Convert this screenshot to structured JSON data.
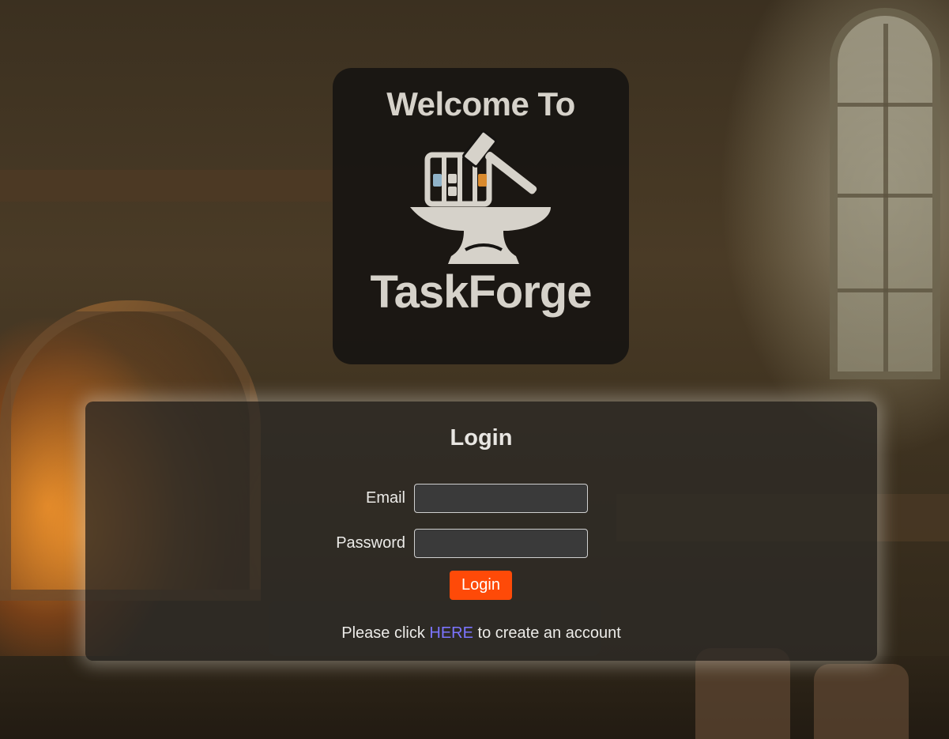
{
  "logo": {
    "welcome_text": "Welcome To",
    "brand_name": "TaskForge",
    "colors": {
      "card_bg": "#161412",
      "logo_fg": "#d6d2ca",
      "kanban_blue": "#8fb2c8",
      "kanban_orange": "#d98a2e"
    },
    "icon": "hammer-anvil-kanban-icon"
  },
  "login": {
    "title": "Login",
    "email_label": "Email",
    "email_value": "",
    "password_label": "Password",
    "password_value": "",
    "button_label": "Login",
    "signup_prefix": "Please click ",
    "signup_link_text": "HERE",
    "signup_suffix": " to create an account",
    "colors": {
      "button_bg": "#fe4a08",
      "link": "#7b74ff",
      "panel_bg": "#2d2a26"
    }
  }
}
